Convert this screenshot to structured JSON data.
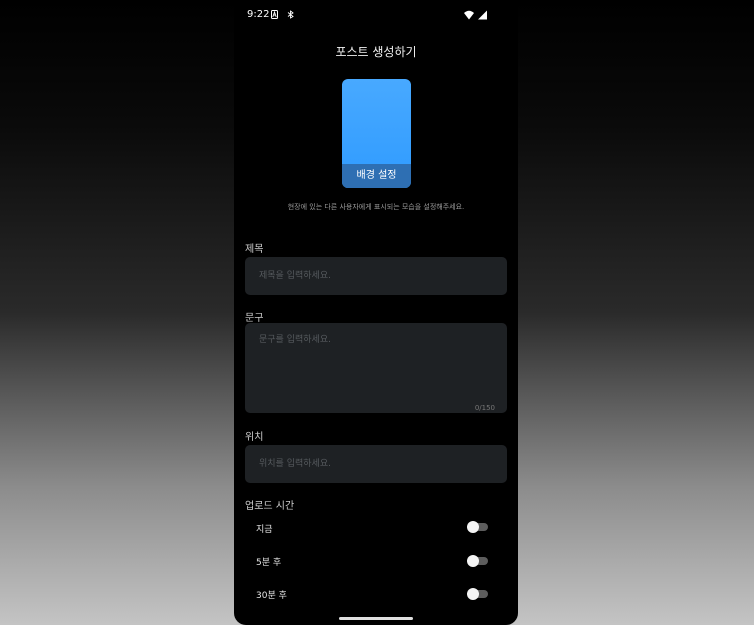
{
  "status_bar": {
    "time": "9:22",
    "icons": [
      "notification-a-icon",
      "cast-icon",
      "wifi-icon",
      "signal-icon"
    ]
  },
  "header": {
    "title": "포스트 생성하기"
  },
  "background": {
    "button_label": "배경 설정",
    "color": "#3ea3ff",
    "description": "현장에 있는 다른 사용자에게 표시되는 모습을 설정해주세요."
  },
  "form": {
    "title": {
      "label": "제목",
      "placeholder": "제목을 입력하세요.",
      "value": ""
    },
    "content": {
      "label": "문구",
      "placeholder": "문구를 입력하세요.",
      "value": "",
      "counter": "0/150"
    },
    "location": {
      "label": "위치",
      "placeholder": "위치를 입력하세요.",
      "value": ""
    }
  },
  "upload_time": {
    "label": "업로드 시간",
    "options": [
      {
        "label": "지금",
        "on": false
      },
      {
        "label": "5분 후",
        "on": false
      },
      {
        "label": "30분 후",
        "on": false
      }
    ]
  }
}
